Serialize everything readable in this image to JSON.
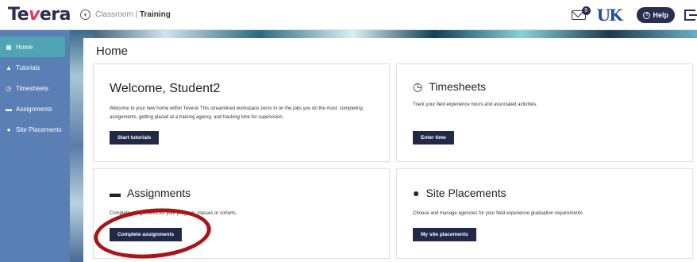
{
  "topbar": {
    "logo_pre": "Te",
    "logo_v": "v",
    "logo_post": "era",
    "breadcrumb_prefix": "Classroom | ",
    "breadcrumb_current": "Training",
    "mail_count": "9",
    "institution_logo": "UK",
    "help_label": "Help"
  },
  "sidebar": {
    "items": [
      {
        "label": "Home",
        "icon": "grid-icon",
        "glyph": "▦"
      },
      {
        "label": "Tutorials",
        "icon": "graduation-cap-icon",
        "glyph": "🎓"
      },
      {
        "label": "Timesheets",
        "icon": "stopwatch-icon",
        "glyph": "⏱"
      },
      {
        "label": "Assignments",
        "icon": "folder-icon",
        "glyph": "▬"
      },
      {
        "label": "Site Placements",
        "icon": "map-pin-icon",
        "glyph": "●"
      }
    ]
  },
  "main": {
    "title": "Home",
    "welcome": {
      "heading": "Welcome, Student2",
      "text": "Welcome to your new home within Tevera! This streamlined workspace zeros in on the jobs you do the most: completing assignments, getting placed at a training agency, and tracking time for supervision.",
      "button": "Start tutorials"
    },
    "timesheets": {
      "heading": "Timesheets",
      "text": "Track your field experience hours and associated activities.",
      "button": "Enter time"
    },
    "assignments": {
      "heading": "Assignments",
      "text": "Complete assignments for your program, classes or cohorts.",
      "button": "Complete assignments"
    },
    "placements": {
      "heading": "Site Placements",
      "text": "Choose and manage agencies for your field experience graduation requirements.",
      "button": "My site placements"
    }
  },
  "colors": {
    "brand_navy": "#2b2d52",
    "brand_pink": "#e23b5d",
    "sidebar": "#5a7fb4",
    "active": "#50a5b5",
    "highlight_ring": "#a81418"
  }
}
